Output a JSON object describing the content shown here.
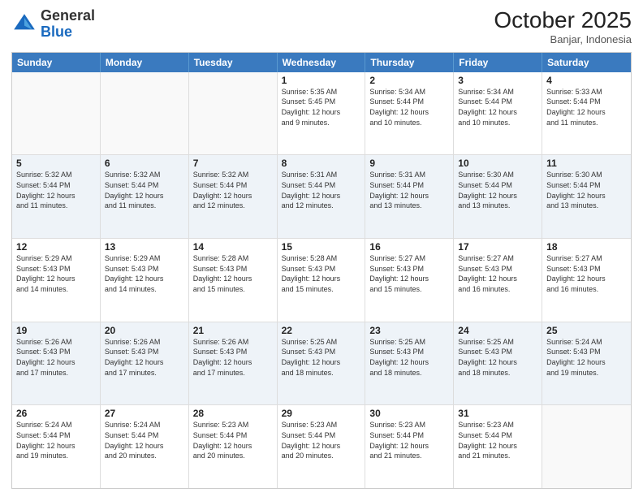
{
  "logo": {
    "general": "General",
    "blue": "Blue"
  },
  "header": {
    "month": "October 2025",
    "location": "Banjar, Indonesia"
  },
  "days": [
    "Sunday",
    "Monday",
    "Tuesday",
    "Wednesday",
    "Thursday",
    "Friday",
    "Saturday"
  ],
  "rows": [
    [
      {
        "day": "",
        "info": ""
      },
      {
        "day": "",
        "info": ""
      },
      {
        "day": "",
        "info": ""
      },
      {
        "day": "1",
        "info": "Sunrise: 5:35 AM\nSunset: 5:45 PM\nDaylight: 12 hours\nand 9 minutes."
      },
      {
        "day": "2",
        "info": "Sunrise: 5:34 AM\nSunset: 5:44 PM\nDaylight: 12 hours\nand 10 minutes."
      },
      {
        "day": "3",
        "info": "Sunrise: 5:34 AM\nSunset: 5:44 PM\nDaylight: 12 hours\nand 10 minutes."
      },
      {
        "day": "4",
        "info": "Sunrise: 5:33 AM\nSunset: 5:44 PM\nDaylight: 12 hours\nand 11 minutes."
      }
    ],
    [
      {
        "day": "5",
        "info": "Sunrise: 5:32 AM\nSunset: 5:44 PM\nDaylight: 12 hours\nand 11 minutes."
      },
      {
        "day": "6",
        "info": "Sunrise: 5:32 AM\nSunset: 5:44 PM\nDaylight: 12 hours\nand 11 minutes."
      },
      {
        "day": "7",
        "info": "Sunrise: 5:32 AM\nSunset: 5:44 PM\nDaylight: 12 hours\nand 12 minutes."
      },
      {
        "day": "8",
        "info": "Sunrise: 5:31 AM\nSunset: 5:44 PM\nDaylight: 12 hours\nand 12 minutes."
      },
      {
        "day": "9",
        "info": "Sunrise: 5:31 AM\nSunset: 5:44 PM\nDaylight: 12 hours\nand 13 minutes."
      },
      {
        "day": "10",
        "info": "Sunrise: 5:30 AM\nSunset: 5:44 PM\nDaylight: 12 hours\nand 13 minutes."
      },
      {
        "day": "11",
        "info": "Sunrise: 5:30 AM\nSunset: 5:44 PM\nDaylight: 12 hours\nand 13 minutes."
      }
    ],
    [
      {
        "day": "12",
        "info": "Sunrise: 5:29 AM\nSunset: 5:43 PM\nDaylight: 12 hours\nand 14 minutes."
      },
      {
        "day": "13",
        "info": "Sunrise: 5:29 AM\nSunset: 5:43 PM\nDaylight: 12 hours\nand 14 minutes."
      },
      {
        "day": "14",
        "info": "Sunrise: 5:28 AM\nSunset: 5:43 PM\nDaylight: 12 hours\nand 15 minutes."
      },
      {
        "day": "15",
        "info": "Sunrise: 5:28 AM\nSunset: 5:43 PM\nDaylight: 12 hours\nand 15 minutes."
      },
      {
        "day": "16",
        "info": "Sunrise: 5:27 AM\nSunset: 5:43 PM\nDaylight: 12 hours\nand 15 minutes."
      },
      {
        "day": "17",
        "info": "Sunrise: 5:27 AM\nSunset: 5:43 PM\nDaylight: 12 hours\nand 16 minutes."
      },
      {
        "day": "18",
        "info": "Sunrise: 5:27 AM\nSunset: 5:43 PM\nDaylight: 12 hours\nand 16 minutes."
      }
    ],
    [
      {
        "day": "19",
        "info": "Sunrise: 5:26 AM\nSunset: 5:43 PM\nDaylight: 12 hours\nand 17 minutes."
      },
      {
        "day": "20",
        "info": "Sunrise: 5:26 AM\nSunset: 5:43 PM\nDaylight: 12 hours\nand 17 minutes."
      },
      {
        "day": "21",
        "info": "Sunrise: 5:26 AM\nSunset: 5:43 PM\nDaylight: 12 hours\nand 17 minutes."
      },
      {
        "day": "22",
        "info": "Sunrise: 5:25 AM\nSunset: 5:43 PM\nDaylight: 12 hours\nand 18 minutes."
      },
      {
        "day": "23",
        "info": "Sunrise: 5:25 AM\nSunset: 5:43 PM\nDaylight: 12 hours\nand 18 minutes."
      },
      {
        "day": "24",
        "info": "Sunrise: 5:25 AM\nSunset: 5:43 PM\nDaylight: 12 hours\nand 18 minutes."
      },
      {
        "day": "25",
        "info": "Sunrise: 5:24 AM\nSunset: 5:43 PM\nDaylight: 12 hours\nand 19 minutes."
      }
    ],
    [
      {
        "day": "26",
        "info": "Sunrise: 5:24 AM\nSunset: 5:44 PM\nDaylight: 12 hours\nand 19 minutes."
      },
      {
        "day": "27",
        "info": "Sunrise: 5:24 AM\nSunset: 5:44 PM\nDaylight: 12 hours\nand 20 minutes."
      },
      {
        "day": "28",
        "info": "Sunrise: 5:23 AM\nSunset: 5:44 PM\nDaylight: 12 hours\nand 20 minutes."
      },
      {
        "day": "29",
        "info": "Sunrise: 5:23 AM\nSunset: 5:44 PM\nDaylight: 12 hours\nand 20 minutes."
      },
      {
        "day": "30",
        "info": "Sunrise: 5:23 AM\nSunset: 5:44 PM\nDaylight: 12 hours\nand 21 minutes."
      },
      {
        "day": "31",
        "info": "Sunrise: 5:23 AM\nSunset: 5:44 PM\nDaylight: 12 hours\nand 21 minutes."
      },
      {
        "day": "",
        "info": ""
      }
    ]
  ]
}
